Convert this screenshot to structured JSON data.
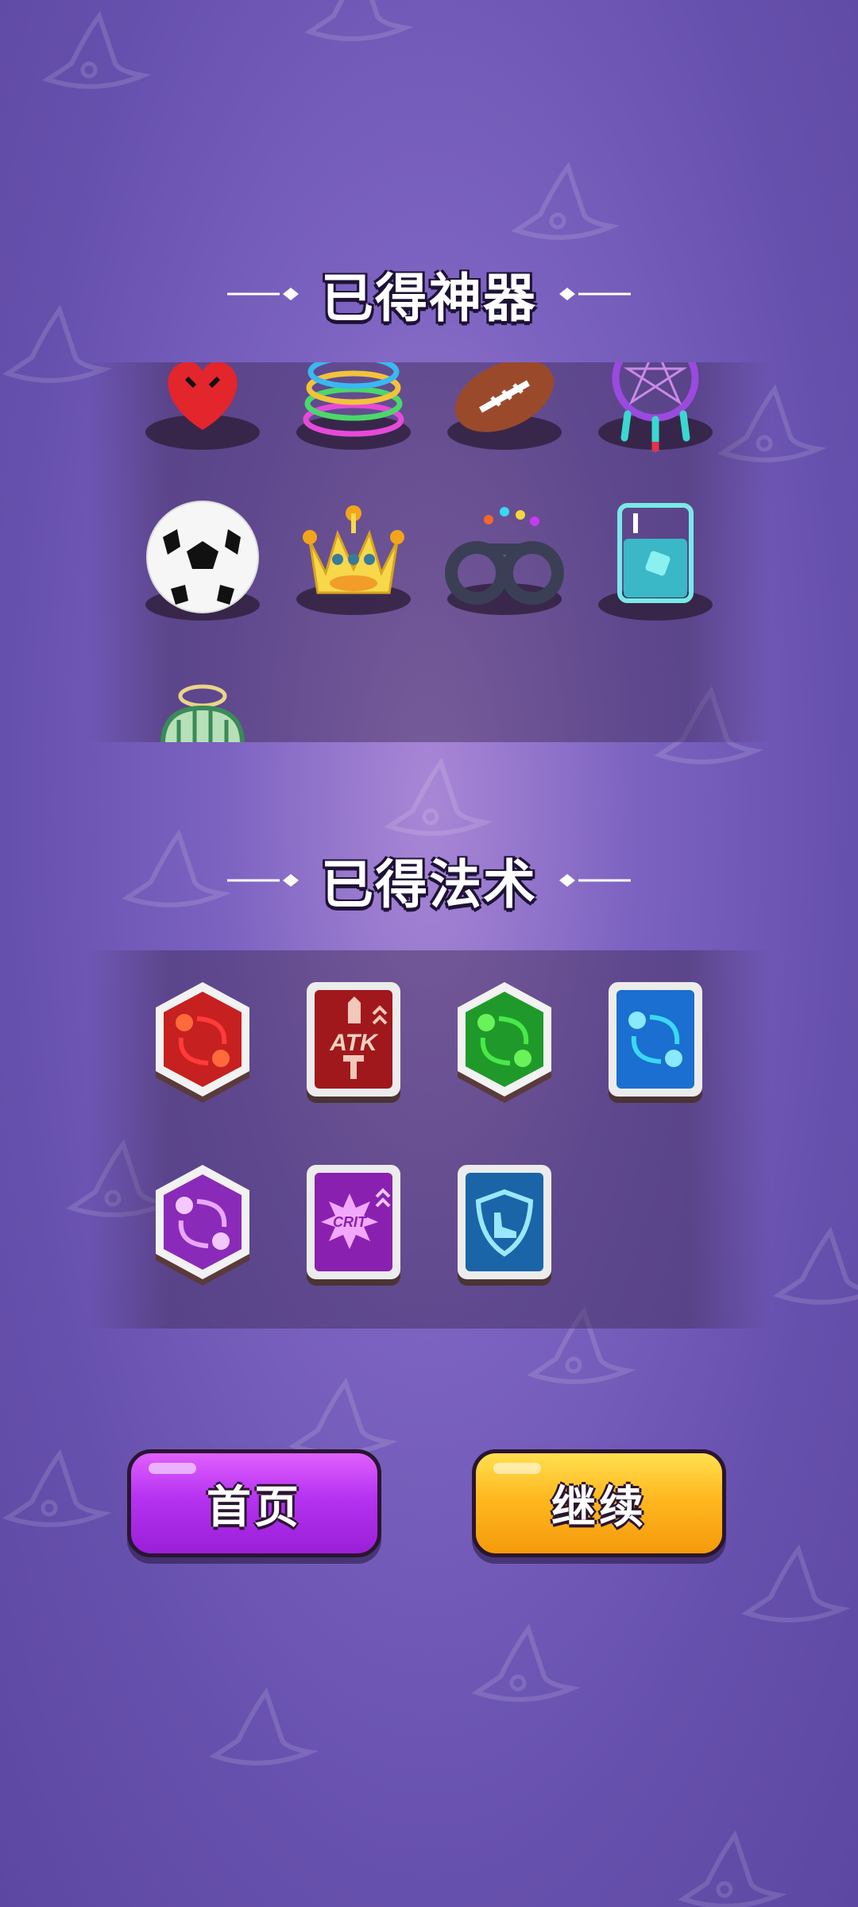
{
  "artifacts_section": {
    "title": "已得神器",
    "items": [
      {
        "icon": "red-heart-icon"
      },
      {
        "icon": "rainbow-spring-icon"
      },
      {
        "icon": "football-icon"
      },
      {
        "icon": "dreamcatcher-icon"
      },
      {
        "icon": "soccer-ball-icon"
      },
      {
        "icon": "crown-icon"
      },
      {
        "icon": "handcuffs-icon"
      },
      {
        "icon": "ice-water-glass-icon"
      },
      {
        "icon": "birdcage-icon"
      }
    ]
  },
  "spells_section": {
    "title": "已得法术",
    "items": [
      {
        "icon": "red-orbit-spell-icon",
        "color": "#c62020"
      },
      {
        "icon": "atk-up-spell-icon",
        "label": "ATK",
        "color": "#a0181c"
      },
      {
        "icon": "green-orbit-spell-icon",
        "color": "#1f9a2a"
      },
      {
        "icon": "blue-orbit-spell-icon",
        "color": "#1a6fd0"
      },
      {
        "icon": "purple-orbit-spell-icon",
        "color": "#8a2ab8"
      },
      {
        "icon": "crit-up-spell-icon",
        "label": "CRIT",
        "color": "#8a20b0"
      },
      {
        "icon": "speed-shield-spell-icon",
        "color": "#1a64a8"
      }
    ]
  },
  "buttons": {
    "home_label": "首页",
    "continue_label": "继续"
  },
  "colors": {
    "background": "#6a55b3",
    "home_button": "#b532f0",
    "continue_button": "#ffb81f"
  }
}
